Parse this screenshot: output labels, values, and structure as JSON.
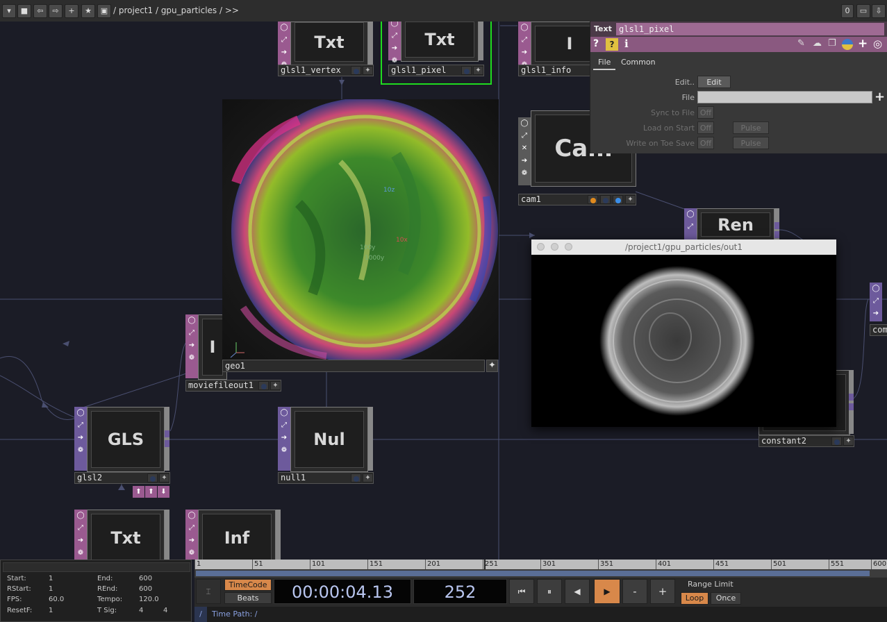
{
  "topbar": {
    "path": "/ project1 / gpu_particles / >>",
    "counter": "0"
  },
  "nodes": {
    "glsl1_vertex": {
      "name": "glsl1_vertex",
      "tag": "Txt"
    },
    "glsl1_pixel": {
      "name": "glsl1_pixel",
      "tag": "Txt"
    },
    "glsl1_info": {
      "name": "glsl1_info",
      "tag": "I"
    },
    "cam1": {
      "name": "cam1",
      "tag": "Cam"
    },
    "render": {
      "tag": "Ren"
    },
    "moviefileout1": {
      "name": "moviefileout1",
      "tag": "I"
    },
    "glsl2": {
      "name": "glsl2",
      "tag": "GLS"
    },
    "null1": {
      "name": "null1",
      "tag": "Nul"
    },
    "text_bottom": {
      "tag": "Txt"
    },
    "info_bottom": {
      "tag": "Inf"
    },
    "constant2": {
      "name": "constant2"
    },
    "comp": {
      "name": "com"
    }
  },
  "geo_viewer": {
    "name": "geo1",
    "axis_labels": [
      "10z",
      "10x",
      "100y",
      "1000y"
    ]
  },
  "out_window": {
    "title": "/project1/gpu_particles/out1"
  },
  "param_panel": {
    "type_label": "Text",
    "op_name": "glsl1_pixel",
    "tabs": [
      "File",
      "Common"
    ],
    "params": {
      "edit_label": "Edit..",
      "edit_button": "Edit",
      "file_label": "File",
      "sync_label": "Sync to File",
      "sync_value": "Off",
      "load_label": "Load on Start",
      "load_value": "Off",
      "load_pulse": "Pulse",
      "write_label": "Write on Toe Save",
      "write_value": "Off",
      "write_pulse": "Pulse"
    }
  },
  "timeline": {
    "ticks": [
      "1",
      "51",
      "101",
      "151",
      "201",
      "251",
      "301",
      "351",
      "401",
      "451",
      "501",
      "551",
      "600"
    ],
    "stats": {
      "start_label": "Start:",
      "start": "1",
      "end_label": "End:",
      "end": "600",
      "rstart_label": "RStart:",
      "rstart": "1",
      "rend_label": "REnd:",
      "rend": "600",
      "fps_label": "FPS:",
      "fps": "60.0",
      "tempo_label": "Tempo:",
      "tempo": "120.0",
      "resetf_label": "ResetF:",
      "resetf": "1",
      "tsig_label": "T Sig:",
      "tsig_a": "4",
      "tsig_b": "4"
    },
    "timecode_label": "TimeCode",
    "beats_label": "Beats",
    "timecode": "00:00:04.13",
    "frame": "252",
    "minus": "-",
    "plus": "+",
    "range_limit_label": "Range Limit",
    "loop_label": "Loop",
    "once_label": "Once",
    "time_path_label": "Time Path: /",
    "slash": "/"
  },
  "colors": {
    "accent_orange": "#d8884a",
    "select_green": "#1fdc1f",
    "op_pink": "#9a5a90",
    "op_purple": "#6d5a9c"
  }
}
